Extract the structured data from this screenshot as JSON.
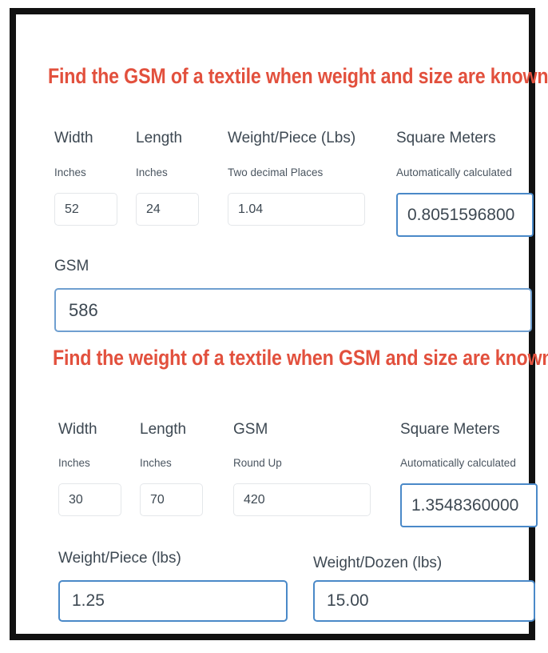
{
  "colors": {
    "heading_red": "#e2503d",
    "label_slate": "#3d4852",
    "input_border": "#e4e7ea",
    "highlight_border": "#4a89c8",
    "frame_black": "#111111"
  },
  "section_one": {
    "title": "Find the GSM of a textile when weight and size are known",
    "fields": [
      {
        "label": "Width",
        "hint": "Inches",
        "value": "52"
      },
      {
        "label": "Length",
        "hint": "Inches",
        "value": "24"
      },
      {
        "label": "Weight/Piece (Lbs)",
        "hint": "Two decimal Places",
        "value": "1.04"
      },
      {
        "label": "Square Meters",
        "hint": "Automatically calculated",
        "value": "0.8051596800"
      }
    ],
    "result": {
      "label": "GSM",
      "value": "586"
    }
  },
  "section_two": {
    "title": "Find the weight of a textile when GSM and size are known",
    "fields": [
      {
        "label": "Width",
        "hint": "Inches",
        "value": "30"
      },
      {
        "label": "Length",
        "hint": "Inches",
        "value": "70"
      },
      {
        "label": "GSM",
        "hint": "Round Up",
        "value": "420"
      },
      {
        "label": "Square Meters",
        "hint": "Automatically calculated",
        "value": "1.3548360000"
      }
    ],
    "results": [
      {
        "label": "Weight/Piece (lbs)",
        "value": "1.25"
      },
      {
        "label": "Weight/Dozen (lbs)",
        "value": "15.00"
      }
    ]
  }
}
